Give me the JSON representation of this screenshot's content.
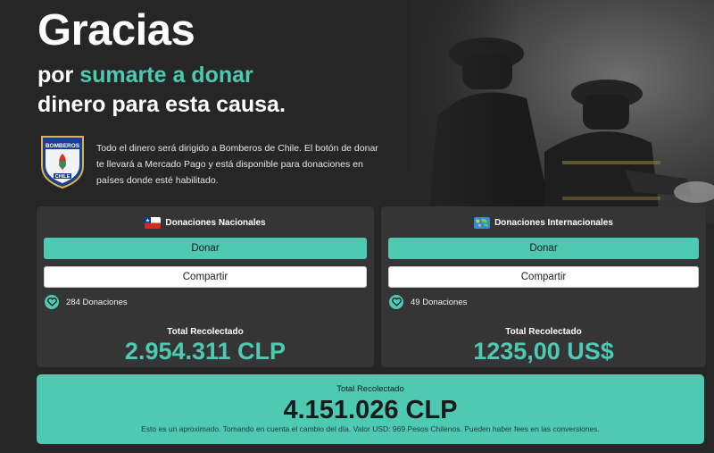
{
  "hero": {
    "title": "Gracias",
    "subtitle_prefix": "por",
    "subtitle_accent": "sumarte a donar",
    "subtitle_line2": "dinero para esta causa.",
    "description": "Todo el dinero será dirigido a Bomberos de Chile. El botón de donar te llevará a Mercado Pago y está disponible para donaciones en países donde esté habilitado."
  },
  "logo": {
    "text_top": "BOMBEROS",
    "text_bottom": "CHILE"
  },
  "national": {
    "heading": "Donaciones Nacionales",
    "donate_label": "Donar",
    "share_label": "Compartir",
    "donations_count": "284 Donaciones",
    "total_label": "Total Recolectado",
    "total_value": "2.954.311 CLP"
  },
  "international": {
    "heading": "Donaciones Internacionales",
    "donate_label": "Donar",
    "share_label": "Compartir",
    "donations_count": "49 Donaciones",
    "total_label": "Total Recolectado",
    "total_value": "1235,00 US$"
  },
  "grand_total": {
    "label": "Total Recolectado",
    "value": "4.151.026 CLP",
    "note": "Esto es un aproximado. Tomando en cuenta el cambio del día. Valor USD: 969 Pesos Chilenos. Pueden haber fees en las conversiones."
  },
  "colors": {
    "accent": "#4ecab2",
    "background": "#262626",
    "card": "#353535"
  }
}
